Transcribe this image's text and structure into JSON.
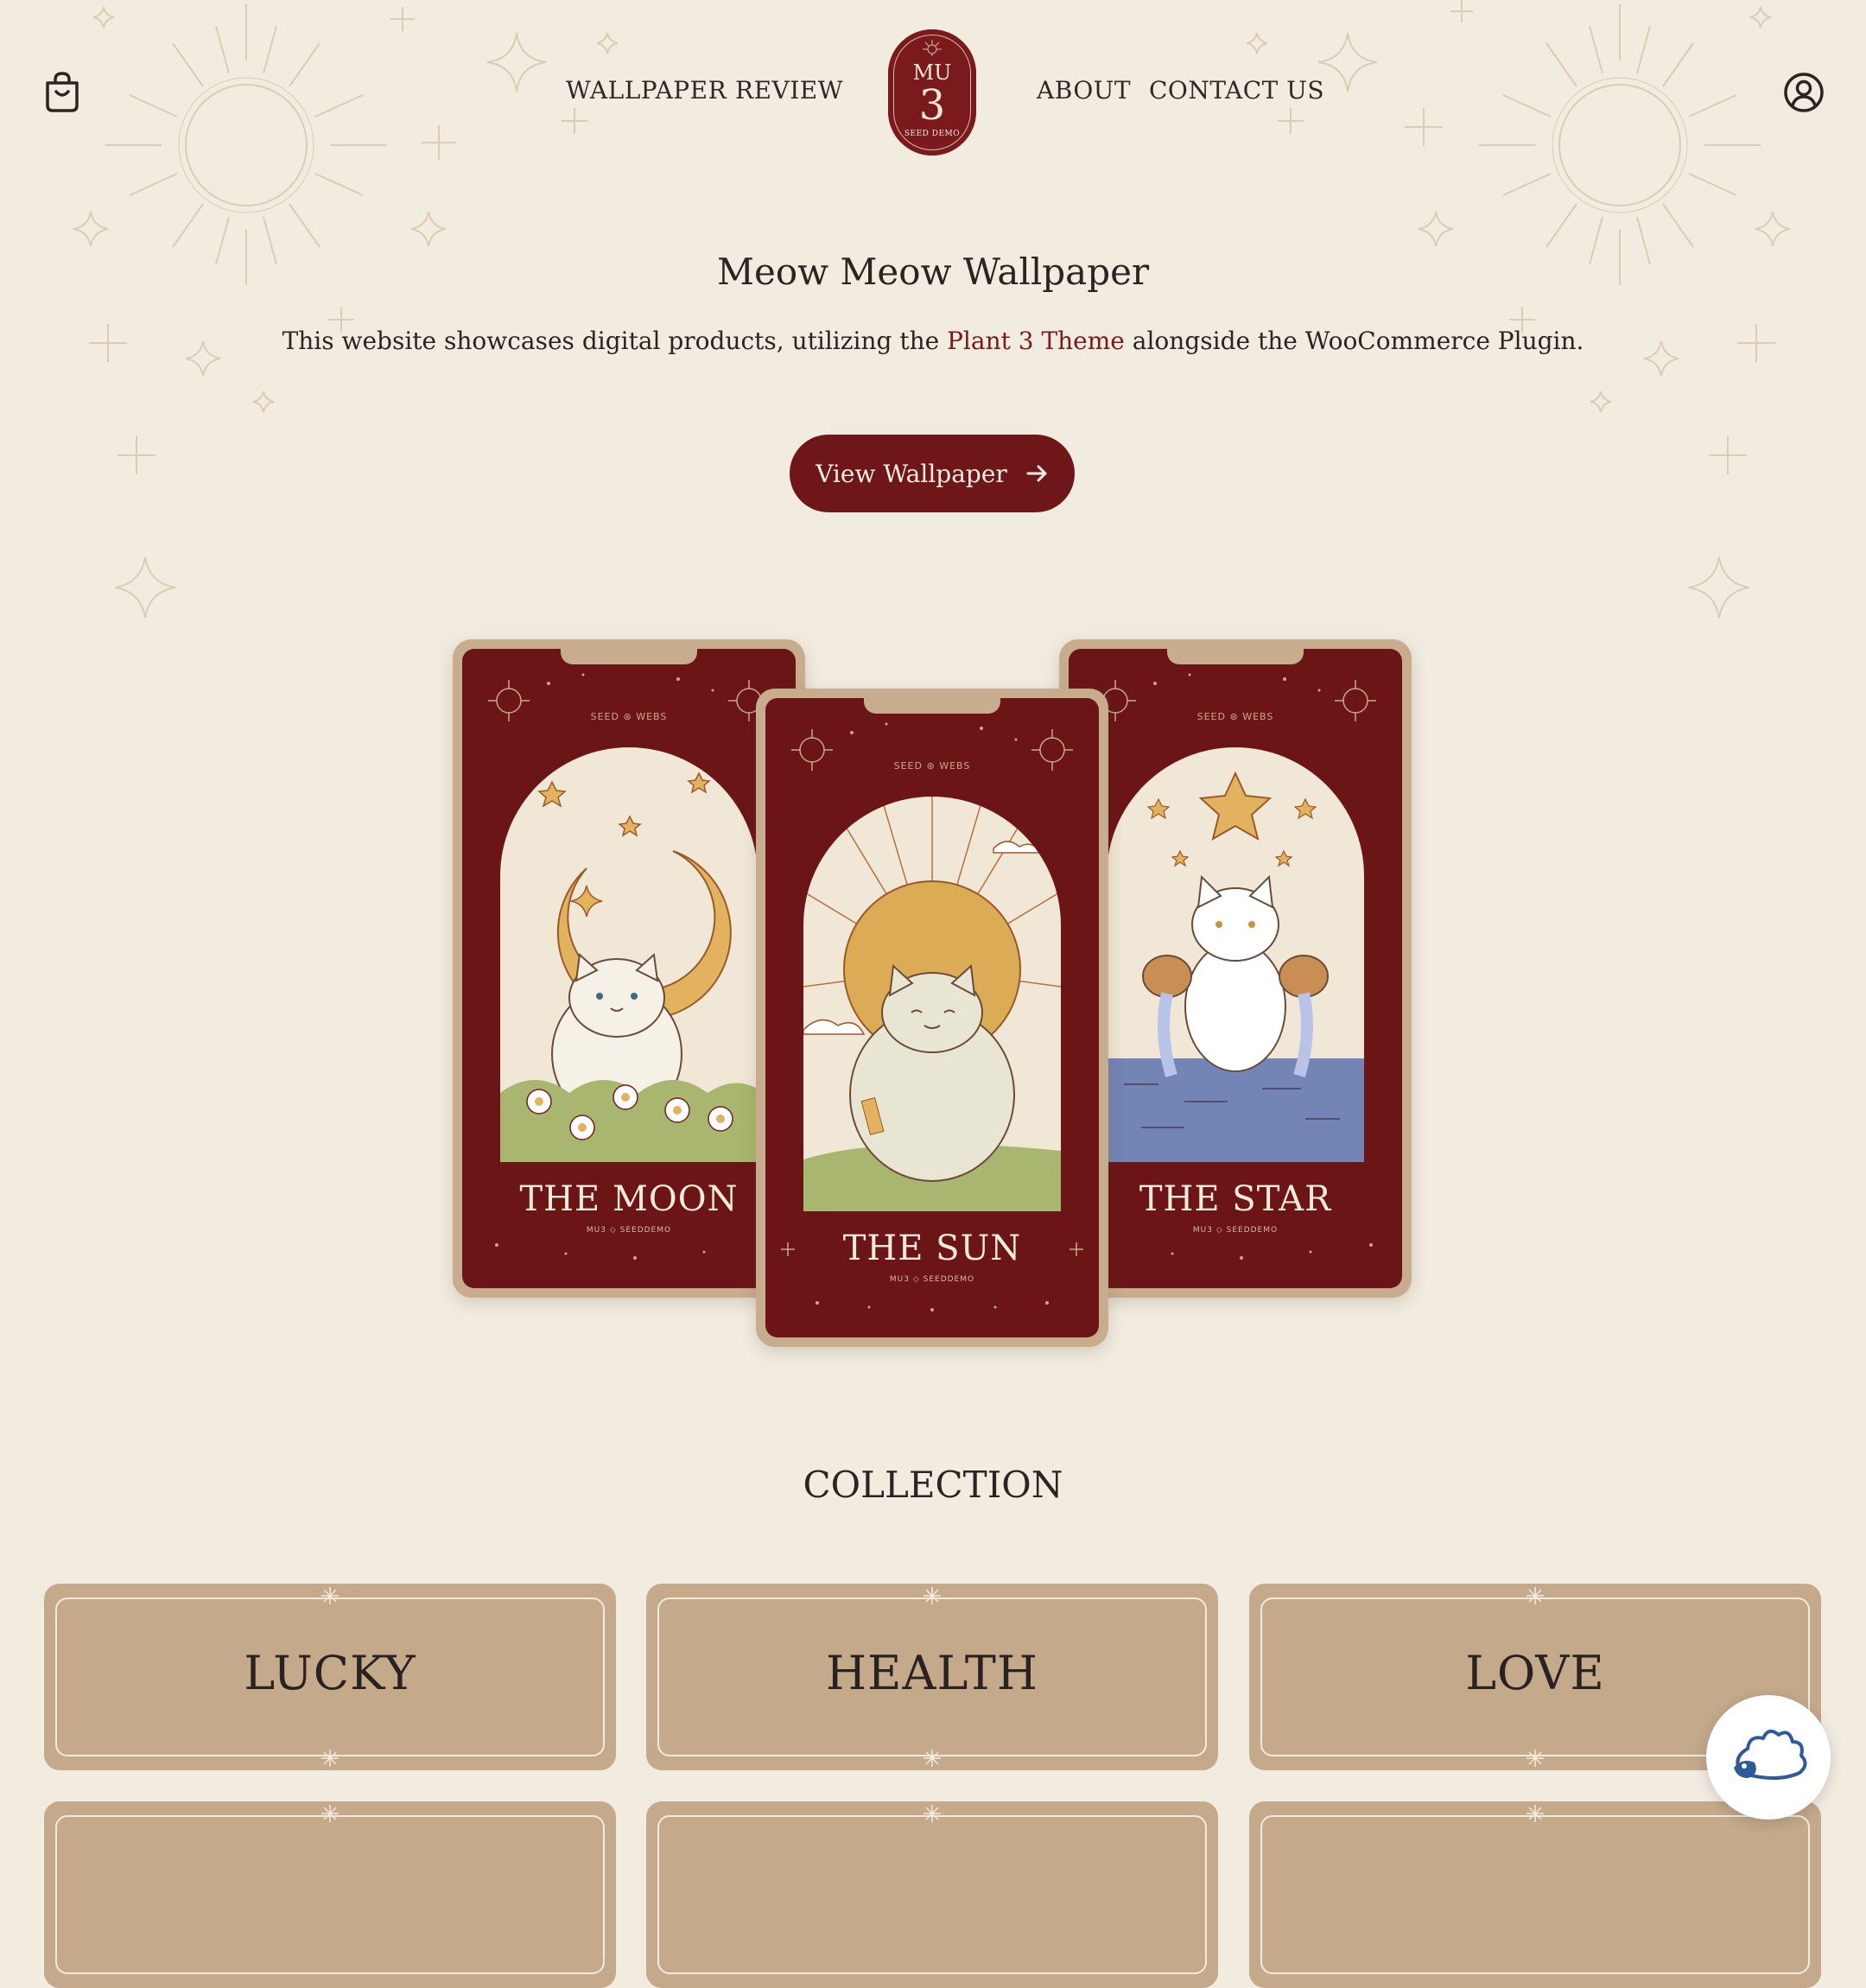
{
  "header": {
    "nav_left": [
      "WALLPAPER",
      "REVIEW"
    ],
    "nav_right": [
      "ABOUT",
      "CONTACT US"
    ],
    "logo": {
      "top": "MU",
      "number": "3",
      "sub": "SEED DEMO"
    },
    "icons": {
      "cart": "shopping-bag-icon",
      "account": "user-circle-icon"
    }
  },
  "hero": {
    "title": "Meow Meow Wallpaper",
    "desc_before": "This website showcases digital products, utilizing the ",
    "desc_link": "Plant 3 Theme",
    "desc_after": " alongside the WooCommerce Plugin.",
    "cta_label": "View Wallpaper",
    "cta_icon": "arrow-right-icon"
  },
  "phones": [
    {
      "brand": "SEED ⊛ WEBS",
      "title": "THE MOON",
      "sub": "MU3 ◇ SEEDDEMO"
    },
    {
      "brand": "SEED ⊛ WEBS",
      "title": "THE SUN",
      "sub": "MU3 ◇ SEEDDEMO"
    },
    {
      "brand": "SEED ⊛ WEBS",
      "title": "THE STAR",
      "sub": "MU3 ◇ SEEDDEMO"
    }
  ],
  "collection": {
    "title": "COLLECTION",
    "items": [
      "LUCKY",
      "HEALTH",
      "LOVE"
    ]
  },
  "colors": {
    "background": "#f1ebe0",
    "accent": "#6f1718",
    "tile": "#c4a98b",
    "deco": "#ddccb4"
  },
  "chat_widget": {
    "icon": "hedgehog-icon"
  }
}
